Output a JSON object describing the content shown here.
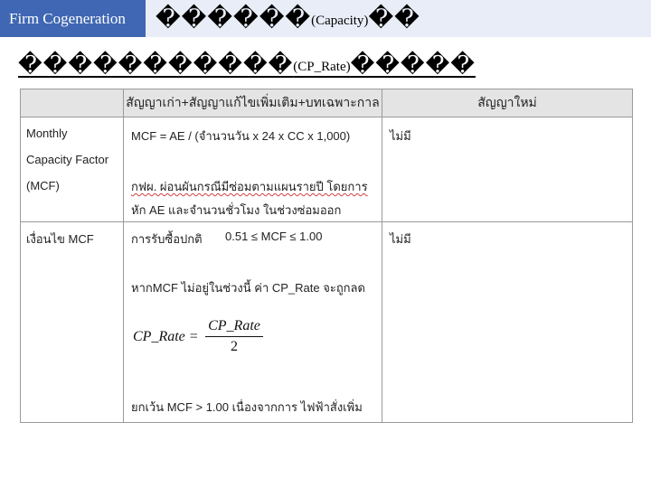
{
  "header": {
    "tag": "Firm Cogeneration",
    "title_glyphs": "������",
    "title_suffix": "(Capacity)",
    "title_tail": "��"
  },
  "subtitle": {
    "glyphs": "�����������",
    "suffix": "(CP_Rate)",
    "tail": "�����"
  },
  "table": {
    "headers": [
      "",
      "สัญญาเก่า+สัญญาแก้ไขเพิ่มเติม+บทเฉพาะกาล",
      "สัญญาใหม่"
    ],
    "row1": {
      "label_lines": [
        "Monthly",
        "Capacity Factor",
        "(MCF)"
      ],
      "old_formula": "MCF = AE / (จำนวนวัน x 24 x CC x 1,000)",
      "old_note_lines": [
        "กฟผ. ผ่อนผันกรณีมีซ่อมตามแผนรายปี โดยการ",
        "หัก AE และจำนวนชั่วโมง ในช่วงซ่อมออก"
      ],
      "new": "ไม่มี"
    },
    "row2": {
      "label": "เงื่อนไข MCF",
      "old_normal": "การรับซื้อปกติ",
      "old_range": "0.51 ≤ MCF ≤ 1.00",
      "old_reduce": "หากMCF ไม่อยู่ในช่วงนี้ ค่า CP_Rate จะถูกลด",
      "formula_lhs": "CP_Rate =",
      "formula_num": "CP_Rate",
      "formula_den": "2",
      "old_except": "ยกเว้น MCF > 1.00 เนื่องจากการ ไฟฟ้าสั่งเพิ่ม",
      "new": "ไม่มี"
    }
  }
}
